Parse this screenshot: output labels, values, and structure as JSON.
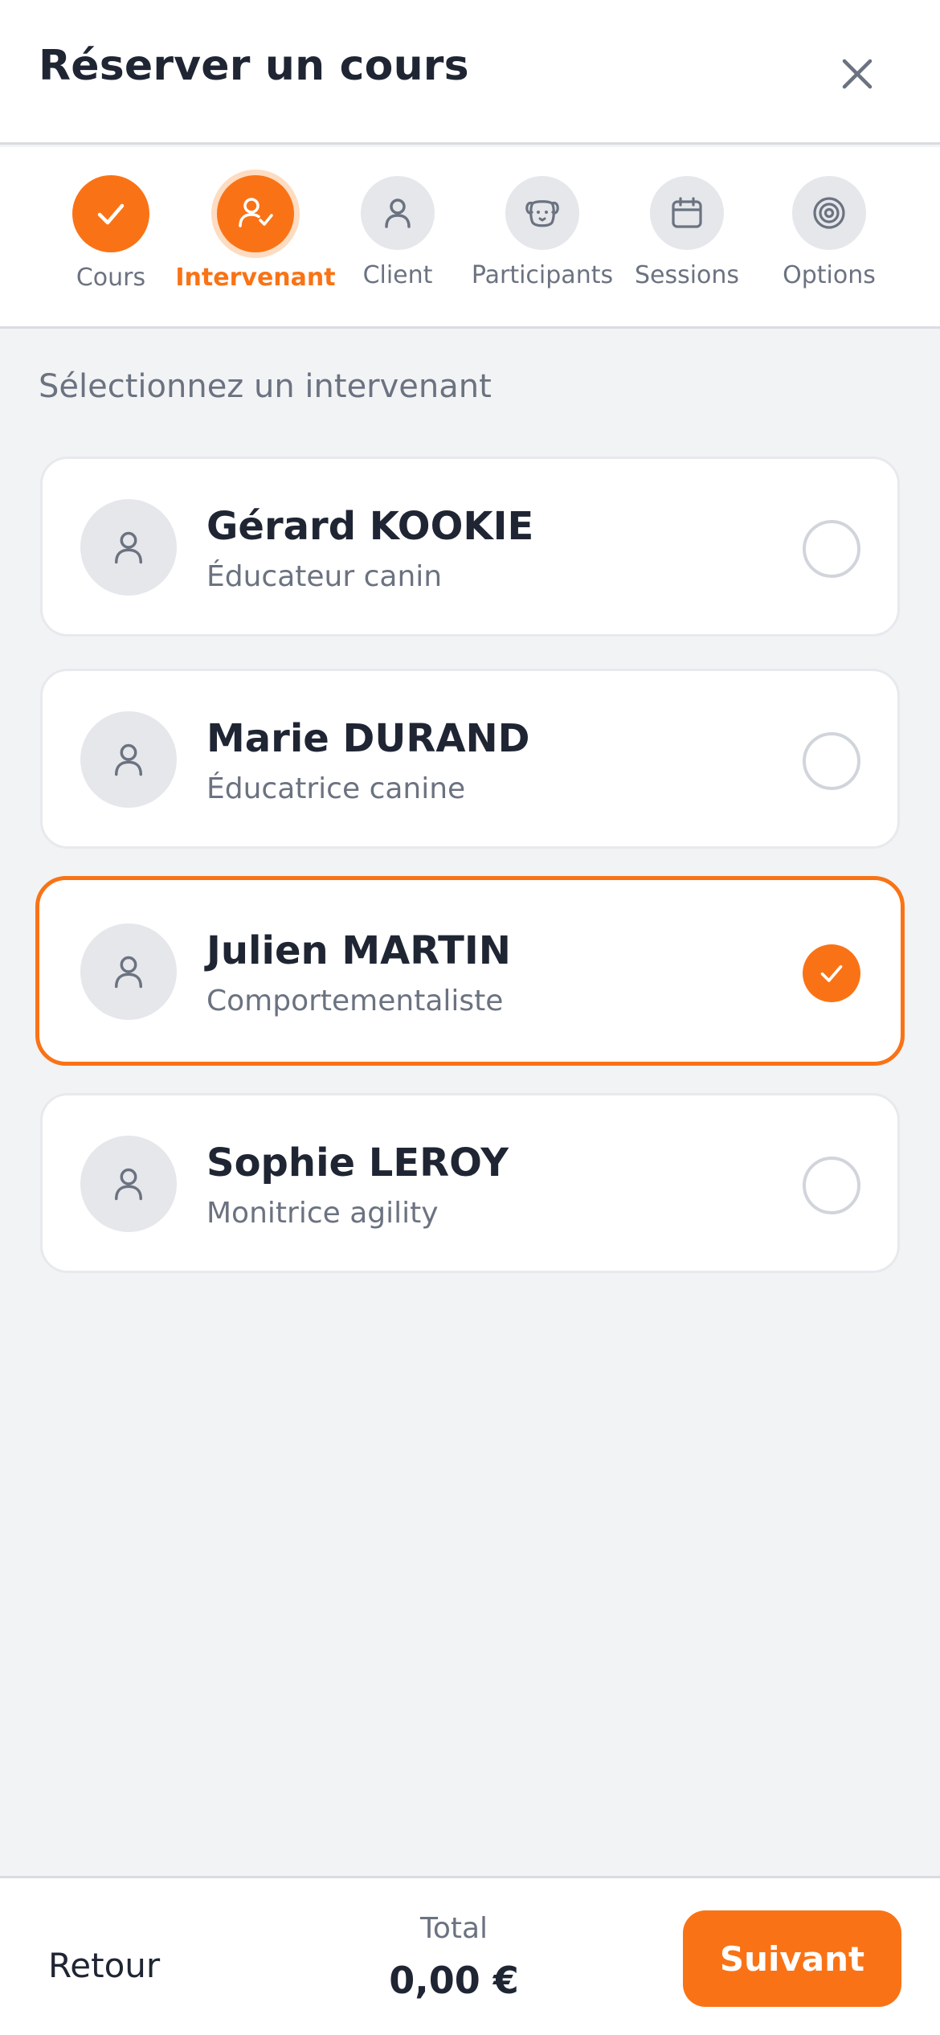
{
  "header": {
    "title": "Réserver un cours",
    "close_icon": "close-icon"
  },
  "stepper": {
    "steps": [
      {
        "label": "Cours",
        "icon": "check-icon",
        "status": "done"
      },
      {
        "label": "Intervenant",
        "icon": "user-check-icon",
        "status": "active"
      },
      {
        "label": "Client",
        "icon": "user-icon",
        "status": "pending"
      },
      {
        "label": "Participants",
        "icon": "dog-icon",
        "status": "pending"
      },
      {
        "label": "Sessions",
        "icon": "calendar-icon",
        "status": "pending"
      },
      {
        "label": "Options",
        "icon": "target-icon",
        "status": "pending"
      }
    ]
  },
  "main": {
    "section_title": "Sélectionnez un intervenant",
    "instructors": [
      {
        "name": "Gérard KOOKIE",
        "role": "Éducateur canin",
        "selected": false
      },
      {
        "name": "Marie DURAND",
        "role": "Éducatrice canine",
        "selected": false
      },
      {
        "name": "Julien MARTIN",
        "role": "Comportementaliste",
        "selected": true
      },
      {
        "name": "Sophie LEROY",
        "role": "Monitrice agility",
        "selected": false
      }
    ]
  },
  "footer": {
    "back_label": "Retour",
    "total_label": "Total",
    "total_value": "0,00 €",
    "next_label": "Suivant"
  },
  "colors": {
    "accent": "#f97316",
    "text_primary": "#1f2533",
    "text_secondary": "#6b7280",
    "background": "#f2f3f5"
  }
}
